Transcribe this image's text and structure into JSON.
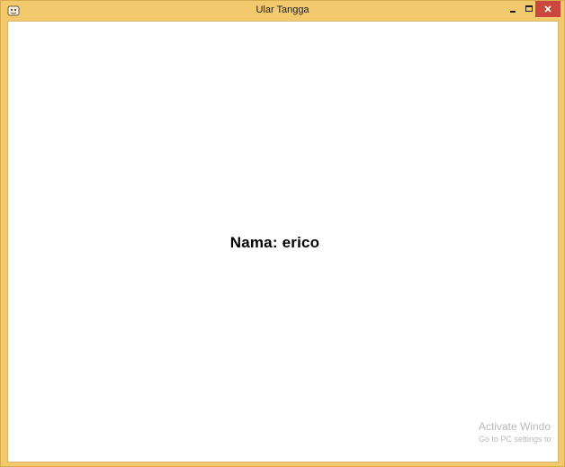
{
  "window": {
    "title": "Ular Tangga",
    "icon": "snake-ladder-app-icon",
    "controls": {
      "minimize": "minimize-icon",
      "maximize": "maximize-icon",
      "close": "close-icon"
    }
  },
  "content": {
    "name_text": "Nama: erico"
  },
  "watermark": {
    "line1": "Activate Windo",
    "line2": "Go to PC settings to"
  },
  "colors": {
    "frame": "#f3c96d",
    "close_button": "#c9473f",
    "background": "#ffffff",
    "text": "#000000"
  }
}
